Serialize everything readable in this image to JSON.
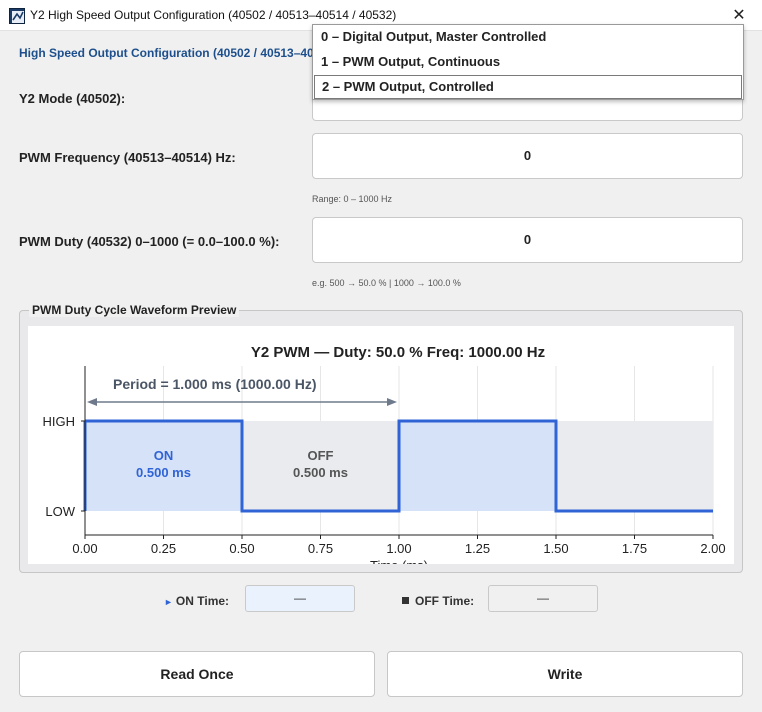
{
  "window": {
    "title": "Y2 High Speed Output Configuration  (40502 / 40513–40514 / 40532)",
    "close_glyph": "✕"
  },
  "header": {
    "text": "High Speed Output Configuration  (40502 / 40513–40"
  },
  "mode": {
    "label": "Y2 Mode  (40502):",
    "options": [
      "0  –  Digital Output, Master Controlled",
      "1  –  PWM Output, Continuous",
      "2  –  PWM Output, Controlled"
    ],
    "highlighted_index": 2
  },
  "frequency": {
    "label": "PWM Frequency  (40513–40514)  Hz:",
    "value": "0",
    "hint": "Range: 0 – 1000 Hz"
  },
  "duty": {
    "label": "PWM Duty  (40532)  0–1000  (= 0.0–100.0 %):",
    "value": "0",
    "hint": "e.g. 500 → 50.0 %  |  1000 → 100.0 %"
  },
  "preview": {
    "group_title": "PWM Duty Cycle Waveform Preview",
    "chart_data": {
      "type": "line",
      "title": "Y2 PWM  —  Duty: 50.0 %   Freq: 1000.00 Hz",
      "xlabel": "Time (ms)",
      "ylabel": "",
      "x_ticks": [
        0.0,
        0.25,
        0.5,
        0.75,
        1.0,
        1.25,
        1.5,
        1.75,
        2.0
      ],
      "x_tick_labels": [
        "0.00",
        "0.25",
        "0.50",
        "0.75",
        "1.00",
        "1.25",
        "1.50",
        "1.75",
        "2.00"
      ],
      "y_tick_labels": [
        "HIGH",
        "LOW"
      ],
      "xlim": [
        0,
        2.0
      ],
      "series": [
        {
          "x": [
            0,
            0.5,
            0.5,
            1.0,
            1.0,
            1.5,
            1.5,
            2.0
          ],
          "y": [
            1,
            1,
            0,
            0,
            1,
            1,
            0,
            0
          ]
        }
      ],
      "annotations": {
        "period": "Period = 1.000 ms  (1000.00 Hz)",
        "on_label": "ON",
        "on_value": "0.500 ms",
        "off_label": "OFF",
        "off_value": "0.500 ms"
      },
      "grid": true,
      "colors": {
        "signal": "#2f63d6",
        "on_fill": "#d6e2f8",
        "off_fill": "#e9ebee",
        "annotation": "#6e7a8c",
        "title": "#222222"
      }
    }
  },
  "timing": {
    "on_icon": "play-triangle-icon",
    "on_label": "ON Time:",
    "on_value": "—",
    "off_icon": "square-icon",
    "off_label": "OFF Time:",
    "off_value": "—",
    "on_box_color": "#eaf2fd",
    "off_box_color": "#f0f0f0"
  },
  "buttons": {
    "read_once": "Read Once",
    "write": "Write"
  }
}
